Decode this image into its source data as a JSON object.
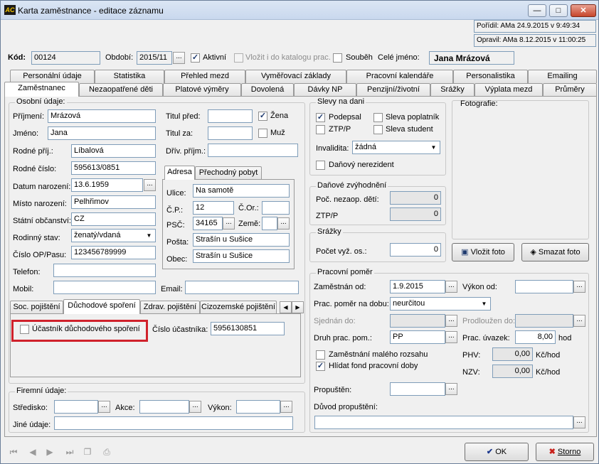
{
  "window": {
    "title": "Karta zaměstnance - editace záznamu",
    "app_icon_text": "AC",
    "minimize": "—",
    "maximize": "□",
    "close": "✕"
  },
  "audit": {
    "created": "Pořídil: AMa 24.9.2015 v 9:49:34",
    "modified": "Opravil: AMa 8.12.2015 v 11:00:25"
  },
  "header": {
    "kod_label": "Kód:",
    "kod_value": "00124",
    "obdobi_label": "Období:",
    "obdobi_value": "2015/11",
    "aktivni_label": "Aktivní",
    "vlozit_label": "Vložit i do katalogu prac.",
    "soubeh_label": "Souběh",
    "cele_jmeno_label": "Celé jméno:",
    "cele_jmeno_value": "Jana Mrázová"
  },
  "tabs_row1": [
    "Personální údaje",
    "Statistika",
    "Přehled mezd",
    "Vyměřovací základy",
    "Pracovní kalendáře",
    "Personalistika",
    "Emailing"
  ],
  "tabs_row2": [
    "Zaměstnanec",
    "Nezaopatřené děti",
    "Platové výměry",
    "Dovolená",
    "Dávky NP",
    "Penzijní/životní",
    "Srážky",
    "Výplata mezd",
    "Průměry"
  ],
  "osobni": {
    "title": "Osobní údaje:",
    "prijmeni_label": "Příjmení:",
    "prijmeni": "Mrázová",
    "jmeno_label": "Jméno:",
    "jmeno": "Jana",
    "rodne_prij_label": "Rodné příj.:",
    "rodne_prij": "Líbalová",
    "rodne_cislo_label": "Rodné číslo:",
    "rodne_cislo": "595613/0851",
    "datum_nar_label": "Datum narození:",
    "datum_nar": "13.6.1959",
    "misto_nar_label": "Místo narození:",
    "misto_nar": "Pelhřimov",
    "obcanstvi_label": "Státní občanství:",
    "obcanstvi": "CZ",
    "stav_label": "Rodinný stav:",
    "stav": "ženatý/vdaná",
    "op_label": "Číslo OP/Pasu:",
    "op": "123456789999",
    "telefon_label": "Telefon:",
    "telefon": "",
    "mobil_label": "Mobil:",
    "mobil": "",
    "email_label": "Email:",
    "email": "",
    "titul_pred_label": "Titul před:",
    "titul_pred": "",
    "titul_za_label": "Titul za:",
    "titul_za": "",
    "drive_prijm_label": "Dřív. příjm.:",
    "drive_prijm": "",
    "zena_label": "Žena",
    "muz_label": "Muž"
  },
  "adresa": {
    "tab1": "Adresa",
    "tab2": "Přechodný pobyt",
    "ulice_label": "Ulice:",
    "ulice": "Na samotě",
    "cp_label": "Č.P.:",
    "cp": "12",
    "cor_label": "Č.Or.:",
    "cor": "",
    "psc_label": "PSČ:",
    "psc": "34165",
    "zeme_label": "Země:",
    "zeme": "",
    "posta_label": "Pošta:",
    "posta": "Strašín u Sušice",
    "obec_label": "Obec:",
    "obec": "Strašín u Sušice"
  },
  "subtabs": [
    "Soc. pojištění",
    "Důchodové spoření",
    "Zdrav. pojištění",
    "Cizozemské pojištění"
  ],
  "duchodove": {
    "ucastnik_label": "Účastník důchodového spoření",
    "cislo_label": "Číslo účastníka:",
    "cislo_value": "5956130851"
  },
  "firemni": {
    "title": "Firemní údaje:",
    "stredisko_label": "Středisko:",
    "akce_label": "Akce:",
    "vykon_label": "Výkon:",
    "jine_label": "Jiné údaje:"
  },
  "slevy": {
    "title": "Slevy na dani",
    "podepsal": "Podepsal",
    "poplatnik": "Sleva poplatník",
    "ztpp": "ZTP/P",
    "student": "Sleva student",
    "invalidita_label": "Invalidita:",
    "invalidita_value": "žádná",
    "nerezident": "Daňový nerezident"
  },
  "danove": {
    "title": "Daňové zvýhodnění",
    "deti_label": "Poč. nezaop. dětí:",
    "deti": "0",
    "ztpp_label": "ZTP/P",
    "ztpp": "0"
  },
  "srazky": {
    "title": "Srážky",
    "pocet_label": "Počet vyž. os.:",
    "pocet": "0"
  },
  "foto": {
    "title": "Fotografie:",
    "vlozit": "Vložit foto",
    "smazat": "Smazat foto"
  },
  "pomer": {
    "title": "Pracovní poměr",
    "zamestnan_label": "Zaměstnán od:",
    "zamestnan": "1.9.2015",
    "vykon_od_label": "Výkon od:",
    "doba_label": "Prac. poměr na dobu:",
    "doba": "neurčitou",
    "sjednan_label": "Sjednán do:",
    "prodlouzen_label": "Prodloužen do:",
    "druh_label": "Druh prac. pom.:",
    "druh": "PP",
    "uvazek_label": "Prac. úvazek:",
    "uvazek": "8,00",
    "hod": "hod",
    "maly_rozsah": "Zaměstnání malého rozsahu",
    "hlidat_fond": "Hlídat fond pracovní doby",
    "phv_label": "PHV:",
    "phv": "0,00",
    "phv_unit": "Kč/hod",
    "nzv_label": "NZV:",
    "nzv": "0,00",
    "nzv_unit": "Kč/hod",
    "propusten_label": "Propuštěn:",
    "duvod_label": "Důvod propuštění:"
  },
  "footer": {
    "ok": "OK",
    "storno": "Storno"
  }
}
